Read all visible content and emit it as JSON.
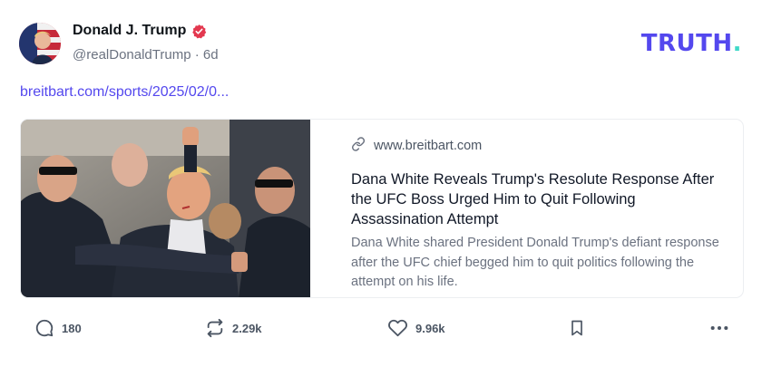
{
  "author": {
    "name": "Donald J. Trump",
    "handle": "@realDonaldTrump",
    "separator": "·",
    "time": "6d"
  },
  "brand": {
    "text": "TRUTH",
    "dot": ".",
    "color": "#5448ee",
    "dot_color": "#3fd9c8"
  },
  "post": {
    "link_text": "breitbart.com/sports/2025/02/0..."
  },
  "card": {
    "domain": "www.breitbart.com",
    "title": "Dana White Reveals Trump's Resolute Response After the UFC Boss Urged Him to Quit Following Assassination Attempt",
    "description": "Dana White shared President Donald Trump's defiant response after the UFC chief begged him to quit politics following the attempt on his life.",
    "link_icon": "link-icon"
  },
  "actions": {
    "replies": {
      "icon": "reply-icon",
      "count": "180"
    },
    "retruths": {
      "icon": "retruth-icon",
      "count": "2.29k"
    },
    "likes": {
      "icon": "heart-icon",
      "count": "9.96k"
    },
    "bookmark": {
      "icon": "bookmark-icon"
    },
    "more": {
      "icon": "more-icon"
    }
  }
}
